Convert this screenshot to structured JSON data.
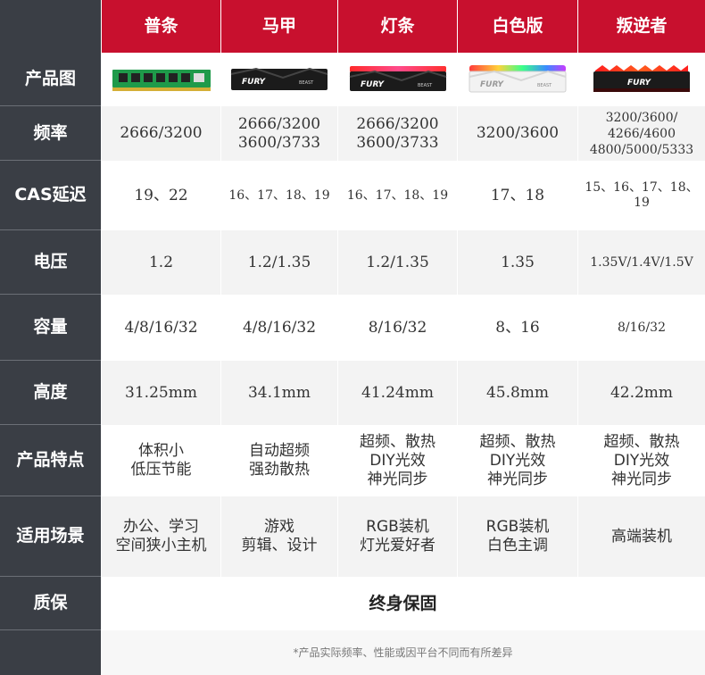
{
  "header": {
    "columns": [
      "普条",
      "马甲",
      "灯条",
      "白色版",
      "叛逆者"
    ]
  },
  "row_labels": {
    "image": "产品图",
    "frequency": "频率",
    "cas": "CAS延迟",
    "voltage": "电压",
    "capacity": "容量",
    "height": "高度",
    "features": "产品特点",
    "scenarios": "适用场景",
    "warranty": "质保"
  },
  "products": [
    {
      "image_icon": "green-ram-stick-icon",
      "frequency": "2666/3200",
      "cas": "19、22",
      "voltage": "1.2",
      "capacity": "4/8/16/32",
      "height": "31.25mm",
      "features": "体积小\n低压节能",
      "scenarios": "办公、学习\n空间狭小主机"
    },
    {
      "image_icon": "black-heatsink-ram-icon",
      "image_text": "FURY",
      "image_subtext": "BEAST",
      "frequency": "2666/3200\n3600/3733",
      "cas": "16、17、18、19",
      "voltage": "1.2/1.35",
      "capacity": "4/8/16/32",
      "height": "34.1mm",
      "features": "自动超频\n强劲散热",
      "scenarios": "游戏\n剪辑、设计"
    },
    {
      "image_icon": "rgb-black-ram-icon",
      "image_text": "FURY",
      "image_subtext": "BEAST",
      "frequency": "2666/3200\n3600/3733",
      "cas": "16、17、18、19",
      "voltage": "1.2/1.35",
      "capacity": "8/16/32",
      "height": "41.24mm",
      "features": "超频、散热\nDIY光效\n神光同步",
      "scenarios": "RGB装机\n灯光爱好者"
    },
    {
      "image_icon": "rgb-white-ram-icon",
      "image_text": "FURY",
      "image_subtext": "BEAST",
      "frequency": "3200/3600",
      "cas": "17、18",
      "voltage": "1.35",
      "capacity": "8、16",
      "height": "45.8mm",
      "features": "超频、散热\nDIY光效\n神光同步",
      "scenarios": "RGB装机\n白色主调"
    },
    {
      "image_icon": "renegade-ram-icon",
      "image_text": "FURY",
      "frequency": "3200/3600/\n4266/4600\n4800/5000/5333",
      "cas": "15、16、17、18、19",
      "voltage": "1.35V/1.4V/1.5V",
      "capacity": "8/16/32",
      "height": "42.2mm",
      "features": "超频、散热\nDIY光效\n神光同步",
      "scenarios": "高端装机"
    }
  ],
  "warranty_value": "终身保固",
  "footnote": "*产品实际频率、性能或因平台不同而有所差异",
  "colors": {
    "header_red": "#c8102e",
    "label_dark": "#3a3e45",
    "row_alt": "#f3f3f3",
    "ram_green": "#1f9a4a",
    "ram_black": "#1b1b1b",
    "ram_white": "#f2f2f2"
  }
}
